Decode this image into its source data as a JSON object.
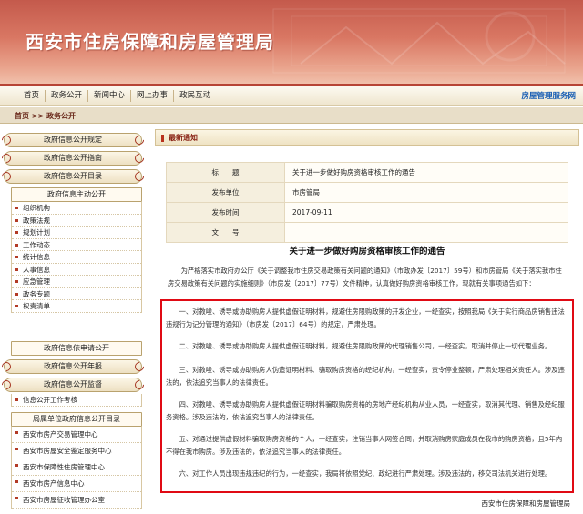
{
  "header": {
    "title": "西安市住房保障和房屋管理局"
  },
  "nav": {
    "items": [
      "首页",
      "政务公开",
      "新闻中心",
      "网上办事",
      "政民互动"
    ],
    "service": "房屋管理服务网"
  },
  "breadcrumb": "首页 >> 政务公开",
  "sidebar": {
    "group1": [
      "政府信息公开规定",
      "政府信息公开指南",
      "政府信息公开目录"
    ],
    "proactive_header": "政府信息主动公开",
    "proactive_items": [
      "组织机构",
      "政策法规",
      "规划计划",
      "工作动态",
      "统计信息",
      "人事信息",
      "应急管理",
      "政务专题",
      "权责清单"
    ],
    "group2": [
      "政府信息依申请公开",
      "政府信息公开年报",
      "政府信息公开监督"
    ],
    "supervision_items": [
      "信息公开工作考核"
    ],
    "units_header": "局属单位政府信息公开目录",
    "units_items": [
      "西安市房产交易管理中心",
      "西安市房屋安全鉴定服务中心",
      "西安市保障性住房管理中心",
      "西安市房产信息中心",
      "西安市房屋征收管理办公室"
    ]
  },
  "main": {
    "section_title": "最新通知",
    "meta": [
      {
        "key": "标　　题",
        "value": "关于进一步做好购房资格审核工作的通告"
      },
      {
        "key": "发布单位",
        "value": "市房管局"
      },
      {
        "key": "发布时间",
        "value": "2017-09-11"
      },
      {
        "key": "文　　号",
        "value": ""
      }
    ],
    "doc_title": "关于进一步做好购房资格审核工作的通告",
    "intro": "为严格落实市政府办公厅《关于调整我市住房交易政策有关问题的通知》（市政办发〔2017〕59号）和市房管局《关于落实我市住房交易政策有关问题的实施细则》（市房发〔2017〕77号）文件精神，认真做好购房资格审核工作，现就有关事项通告如下：",
    "paragraphs": [
      "一、对教唆、诱导或协助购房人提供虚假证明材料，规避住房限购政策的开发企业，一经查实，按照我局《关于实行商品房销售违法违规行为记分管理的通知》（市房发〔2017〕64号）的规定，严肃处理。",
      "二、对教唆、诱导或协助购房人提供虚假证明材料，规避住房限购政策的代理销售公司，一经查实，取消并停止一切代理业务。",
      "三、对教唆、诱导或协助购房人伪造证明材料、骗取购房资格的经纪机构，一经查实，责令停业整顿，严肃处理相关责任人。涉及违法的，依法追究当事人的法律责任。",
      "四、对教唆、诱导或协助购房人提供虚假证明材料骗取购房资格的房地产经纪机构从业人员，一经查实，取消其代理、销售及经纪服务资格。涉及违法的，依法追究当事人的法律责任。",
      "五、对通过提供虚假材料骗取购房资格的个人，一经查实，注销当事人网签合同，并取消购房家庭成员在我市的购房资格，且5年内不得在我市购房。涉及违法的，依法追究当事人的法律责任。",
      "六、对工作人员出现违规违纪的行为，一经查实，我局将依照党纪、政纪进行严肃处理。涉及违法的，移交司法机关进行处理。"
    ],
    "signature": "西安市住房保障和房屋管理局"
  },
  "colors": {
    "accent": "#b8311d",
    "highlight_box": "#e00a14",
    "service_link": "#1a5fb4"
  }
}
